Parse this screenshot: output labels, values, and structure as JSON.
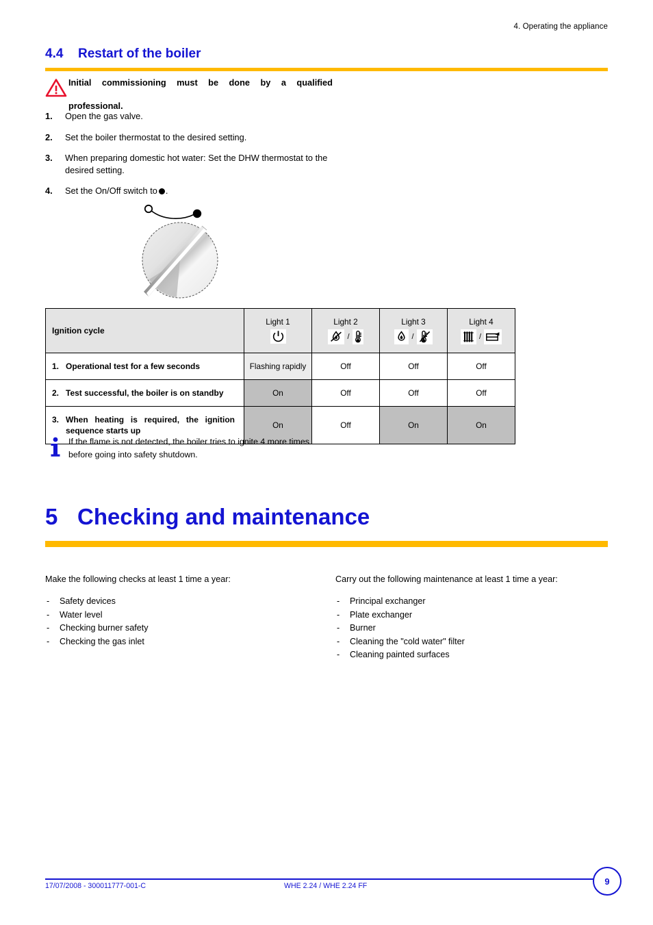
{
  "header": {
    "running_head": "4. Operating the appliance"
  },
  "section": {
    "number": "4.4",
    "title": "Restart of the boiler",
    "accent_color": "#ffb900",
    "heading_color": "#1414d2"
  },
  "warning": {
    "icon": "warning-triangle-icon",
    "line1": "Initial commissioning must be done by a qualified",
    "line2": "professional."
  },
  "steps": [
    {
      "index": "1.",
      "text": "Open the gas valve."
    },
    {
      "index": "2.",
      "text": "Set the boiler thermostat to the desired setting."
    },
    {
      "index": "3.",
      "text": "When preparing domestic hot water: Set the DHW thermostat to the desired setting."
    },
    {
      "index": "4.",
      "text_before": "Set the On/Off switch to",
      "glyph": "filled-circle",
      "text_after": "."
    }
  ],
  "figure": {
    "name": "on-off-knob-illustration",
    "off_marker": "open-circle",
    "on_marker": "filled-circle"
  },
  "table": {
    "corner_label": "Ignition cycle",
    "columns": [
      {
        "name": "Light 1",
        "icons": [
          "power-icon"
        ]
      },
      {
        "name": "Light 2",
        "icons": [
          "flame-crossed-out-icon",
          "thermometer-icon"
        ]
      },
      {
        "name": "Light 3",
        "icons": [
          "flame-icon",
          "thermometer-crossed-out-icon"
        ]
      },
      {
        "name": "Light 4",
        "icons": [
          "radiator-icon",
          "tap-faucet-icon"
        ]
      }
    ],
    "rows": [
      {
        "index": "1.",
        "label": "Operational test for a few seconds",
        "cells": [
          {
            "value": "Flashing rapidly",
            "shade": "light"
          },
          {
            "value": "Off",
            "shade": "none"
          },
          {
            "value": "Off",
            "shade": "none"
          },
          {
            "value": "Off",
            "shade": "none"
          }
        ]
      },
      {
        "index": "2.",
        "label": "Test successful, the boiler is on standby",
        "cells": [
          {
            "value": "On",
            "shade": "dark"
          },
          {
            "value": "Off",
            "shade": "none"
          },
          {
            "value": "Off",
            "shade": "none"
          },
          {
            "value": "Off",
            "shade": "none"
          }
        ]
      },
      {
        "index": "3.",
        "label": "When heating is required, the ignition sequence starts up",
        "cells": [
          {
            "value": "On",
            "shade": "dark"
          },
          {
            "value": "Off",
            "shade": "none"
          },
          {
            "value": "On",
            "shade": "dark"
          },
          {
            "value": "On",
            "shade": "dark"
          }
        ]
      }
    ],
    "shade_light_color": "#ececec",
    "shade_dark_color": "#bfbfbf",
    "header_bg_color": "#e4e4e4"
  },
  "info": {
    "icon": "info-i-icon",
    "line1": "If the flame is not detected, the boiler tries to ignite 4 more times",
    "line2": "before going into safety shutdown."
  },
  "chapter": {
    "number": "5",
    "title": "Checking and maintenance"
  },
  "checks": {
    "intro": "Make the following checks at least 1 time a year:",
    "items": [
      "Safety devices",
      "Water level",
      "Checking burner safety",
      "Checking the gas inlet"
    ]
  },
  "maintenance": {
    "intro": "Carry out the following maintenance at least 1 time a year:",
    "items": [
      "Principal exchanger",
      "Plate exchanger",
      "Burner",
      "Cleaning the \"cold water\" filter",
      "Cleaning painted surfaces"
    ]
  },
  "footer": {
    "left": "17/07/2008 - 300011777-001-C",
    "center": "WHE 2.24 / WHE 2.24 FF",
    "page_number": "9",
    "color": "#1414d2"
  },
  "bullet_dash": "-"
}
